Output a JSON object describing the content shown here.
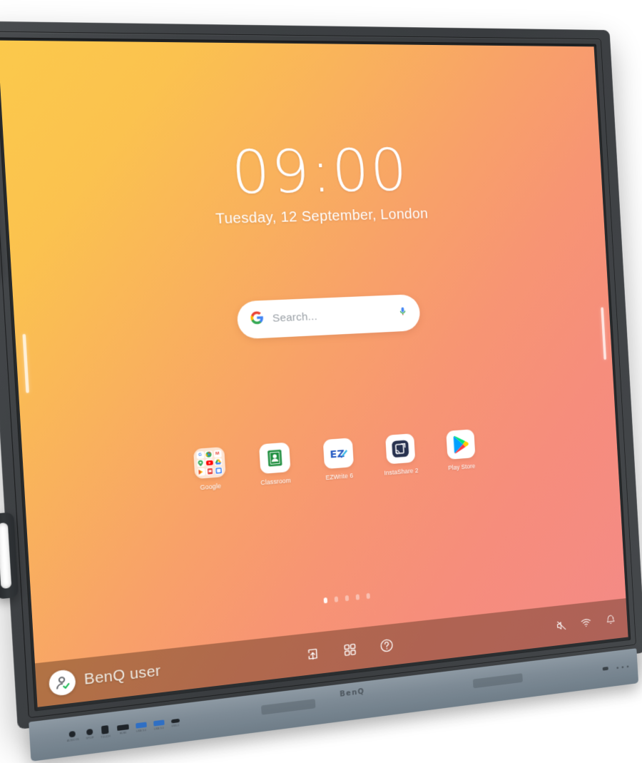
{
  "device": {
    "brand_logo": "BenQ",
    "chassis_color": "#3e4144",
    "bottom_bar_color": "#7d8a95",
    "handles": [
      "carry-handle-top",
      "carry-handle-bottom"
    ],
    "ports": [
      {
        "name": "audio-in-jack",
        "type": "jack",
        "label": "AUDIO IN"
      },
      {
        "name": "audio-out-jack",
        "type": "jack",
        "label": "SPDIF"
      },
      {
        "name": "usb-b-port",
        "type": "usbb",
        "label": "TOUCH"
      },
      {
        "name": "hdmi-port",
        "type": "hdmi",
        "label": "HDMI"
      },
      {
        "name": "usb-3-port-1",
        "type": "usb3",
        "label": "USB 3.0"
      },
      {
        "name": "usb-3-port-2",
        "type": "usb3",
        "label": "USB 3.0"
      },
      {
        "name": "usb-c-port",
        "type": "usbc",
        "label": "USB-C"
      }
    ]
  },
  "wallpaper": {
    "gradient_start": "#fbc94b",
    "gradient_mid": "#f79573",
    "gradient_end": "#f48a86"
  },
  "clock": {
    "time": "09:00",
    "date": "Tuesday, 12 September, London"
  },
  "search": {
    "placeholder": "Search...",
    "logo_icon": "google-g-icon",
    "mic_icon": "microphone-icon"
  },
  "apps": [
    {
      "label": "Google",
      "icon": "google-folder-icon",
      "type": "folder",
      "mini_icons": [
        {
          "name": "google-search-mini-icon",
          "glyph": "G",
          "color": "#ffffff",
          "fg": "#4285f4"
        },
        {
          "name": "chrome-mini-icon",
          "glyph": "◉",
          "color": "#ffffff",
          "fg": "#34a853"
        },
        {
          "name": "gmail-mini-icon",
          "glyph": "M",
          "color": "#ffffff",
          "fg": "#ea4335"
        },
        {
          "name": "maps-mini-icon",
          "glyph": "📍",
          "color": "#ffffff",
          "fg": "#34a853"
        },
        {
          "name": "youtube-mini-icon",
          "glyph": "▶",
          "color": "#ffffff",
          "fg": "#ff0000"
        },
        {
          "name": "drive-mini-icon",
          "glyph": "▲",
          "color": "#ffffff",
          "fg": "#fbbc04"
        },
        {
          "name": "play-mini-icon",
          "glyph": "▶",
          "color": "#ffffff",
          "fg": "#fbbc04"
        },
        {
          "name": "slides-mini-icon",
          "glyph": "▤",
          "color": "#ffffff",
          "fg": "#e8453c"
        },
        {
          "name": "calendar-mini-icon",
          "glyph": "◧",
          "color": "#ffffff",
          "fg": "#4285f4"
        }
      ]
    },
    {
      "label": "Classroom",
      "icon": "google-classroom-icon",
      "type": "app",
      "color": "#1e8e3e"
    },
    {
      "label": "EZWrite 6",
      "icon": "ezwrite-icon",
      "type": "app",
      "color": "#2a5ec4"
    },
    {
      "label": "InstaShare 2",
      "icon": "instashare-icon",
      "type": "app",
      "color": "#27324f"
    },
    {
      "label": "Play Store",
      "icon": "play-store-icon",
      "type": "app",
      "color": "#00a0ff"
    }
  ],
  "page_dots": {
    "count": 5,
    "active_index": 0
  },
  "navbar": {
    "buttons": [
      {
        "name": "share-upload-button",
        "icon": "upload-box-icon"
      },
      {
        "name": "all-apps-button",
        "icon": "grid-four-squares-icon"
      },
      {
        "name": "help-button",
        "icon": "question-mark-circle-icon"
      }
    ]
  },
  "status_icons": [
    {
      "name": "volume-muted-icon",
      "icon": "speaker-mute-icon"
    },
    {
      "name": "wifi-icon",
      "icon": "wifi-icon"
    },
    {
      "name": "notification-icon",
      "icon": "bell-icon"
    }
  ],
  "user": {
    "name": "BenQ user",
    "avatar_icon": "person-verified-avatar-icon",
    "verified_color": "#1db954"
  }
}
